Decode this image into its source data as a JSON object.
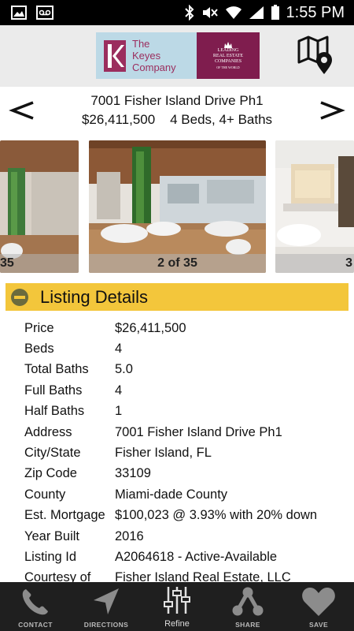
{
  "status_bar": {
    "time": "1:55 PM"
  },
  "header": {
    "brand_line1": "The",
    "brand_line2": "Keyes",
    "brand_line3": "Company",
    "badge_line1": "LEADING",
    "badge_line2": "REAL ESTATE",
    "badge_line3": "COMPANIES",
    "badge_line4": "OF THE WORLD"
  },
  "listing": {
    "address": "7001 Fisher Island Drive Ph1",
    "summary": "$26,411,500    4 Beds, 4+ Baths"
  },
  "photos": {
    "left_caption": "35",
    "center_caption": "2 of 35",
    "right_caption": "3"
  },
  "details": {
    "title": "Listing Details",
    "rows": [
      {
        "label": "Price",
        "value": "$26,411,500"
      },
      {
        "label": "Beds",
        "value": "4"
      },
      {
        "label": "Total Baths",
        "value": "5.0"
      },
      {
        "label": "Full Baths",
        "value": "4"
      },
      {
        "label": "Half Baths",
        "value": "1"
      },
      {
        "label": "Address",
        "value": "7001 Fisher Island Drive Ph1"
      },
      {
        "label": "City/State",
        "value": "Fisher Island, FL"
      },
      {
        "label": "Zip Code",
        "value": "33109"
      },
      {
        "label": "County",
        "value": "Miami-dade County"
      },
      {
        "label": "Est. Mortgage",
        "value": "$100,023 @ 3.93% with 20% down"
      },
      {
        "label": "Year Built",
        "value": "2016"
      },
      {
        "label": "Listing Id",
        "value": "A2064618 - Active-Available"
      },
      {
        "label": "Courtesy of",
        "value": "Fisher Island Real Estate, LLC"
      }
    ]
  },
  "bottom_tabs": [
    {
      "label": "CONTACT",
      "icon": "phone-icon"
    },
    {
      "label": "DIRECTIONS",
      "icon": "navigation-arrow-icon"
    },
    {
      "label": "Refine",
      "icon": "sliders-icon"
    },
    {
      "label": "SHARE",
      "icon": "share-icon"
    },
    {
      "label": "SAVE",
      "icon": "heart-icon"
    }
  ],
  "colors": {
    "accent_yellow": "#f3c63b",
    "brand_maroon": "#7f1d4e",
    "bottom_bar": "#1f1f1f"
  }
}
